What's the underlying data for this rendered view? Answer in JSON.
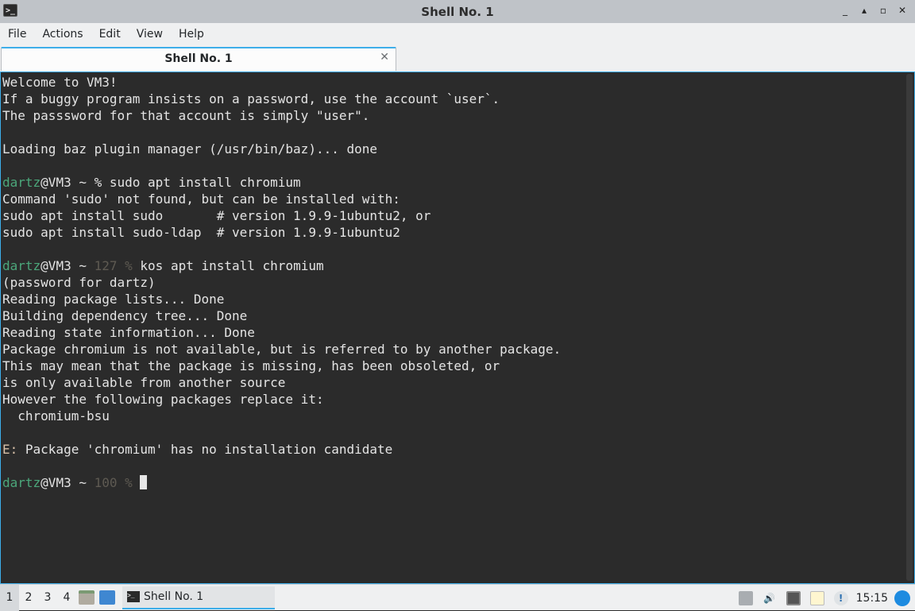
{
  "window": {
    "title": "Shell No. 1",
    "app_icon_glyph": ">_",
    "controls": {
      "minimize": "_",
      "restore": "▴",
      "maximize": "▫",
      "close": "✕"
    }
  },
  "menubar": [
    "File",
    "Actions",
    "Edit",
    "View",
    "Help"
  ],
  "tab": {
    "label": "Shell No. 1",
    "close": "✕"
  },
  "terminal": {
    "lines": [
      [
        {
          "t": "Welcome to VM3!"
        }
      ],
      [
        {
          "t": "If a buggy program insists on a password, use the account `user`."
        }
      ],
      [
        {
          "t": "The passsword for that account is simply \"user\"."
        }
      ],
      [
        {
          "t": ""
        }
      ],
      [
        {
          "t": "Loading baz plugin manager (/usr/bin/baz)... done"
        }
      ],
      [
        {
          "t": ""
        }
      ],
      [
        {
          "t": "dartz",
          "c": "g"
        },
        {
          "t": "@VM3 ~ % sudo apt install chromium"
        }
      ],
      [
        {
          "t": "Command 'sudo' not found, but can be installed with:"
        }
      ],
      [
        {
          "t": "sudo apt install sudo       # version 1.9.9-1ubuntu2, or"
        }
      ],
      [
        {
          "t": "sudo apt install sudo-ldap  # version 1.9.9-1ubuntu2"
        }
      ],
      [
        {
          "t": ""
        }
      ],
      [
        {
          "t": "dartz",
          "c": "g"
        },
        {
          "t": "@VM3 ~ "
        },
        {
          "t": "127 %",
          "c": "dim"
        },
        {
          "t": " kos apt install chromium"
        }
      ],
      [
        {
          "t": "(password for dartz)"
        }
      ],
      [
        {
          "t": "Reading package lists... Done"
        }
      ],
      [
        {
          "t": "Building dependency tree... Done"
        }
      ],
      [
        {
          "t": "Reading state information... Done"
        }
      ],
      [
        {
          "t": "Package chromium is not available, but is referred to by another package."
        }
      ],
      [
        {
          "t": "This may mean that the package is missing, has been obsoleted, or"
        }
      ],
      [
        {
          "t": "is only available from another source"
        }
      ],
      [
        {
          "t": "However the following packages replace it:"
        }
      ],
      [
        {
          "t": "  chromium-bsu"
        }
      ],
      [
        {
          "t": ""
        }
      ],
      [
        {
          "t": "E:",
          "c": "err"
        },
        {
          "t": " Package 'chromium' has no installation candidate"
        }
      ],
      [
        {
          "t": ""
        }
      ],
      [
        {
          "t": "dartz",
          "c": "g"
        },
        {
          "t": "@VM3 ~ "
        },
        {
          "t": "100 %",
          "c": "dim"
        },
        {
          "t": " "
        },
        {
          "cursor": true
        }
      ]
    ]
  },
  "taskbar": {
    "workspaces": [
      "1",
      "2",
      "3",
      "4"
    ],
    "active_workspace": "1",
    "task": {
      "label": "Shell No. 1"
    },
    "notification_glyph": "!",
    "clock": "15:15"
  }
}
